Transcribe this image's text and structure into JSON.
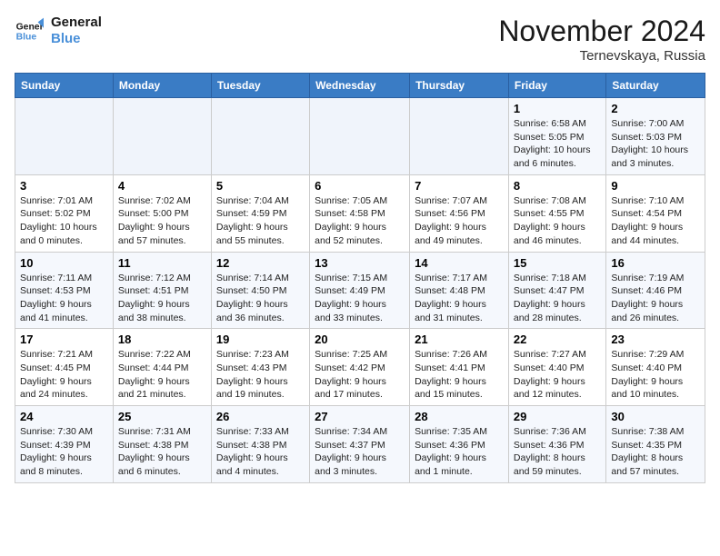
{
  "logo": {
    "line1": "General",
    "line2": "Blue"
  },
  "title": "November 2024",
  "location": "Ternevskaya, Russia",
  "weekdays": [
    "Sunday",
    "Monday",
    "Tuesday",
    "Wednesday",
    "Thursday",
    "Friday",
    "Saturday"
  ],
  "weeks": [
    [
      {
        "day": "",
        "info": ""
      },
      {
        "day": "",
        "info": ""
      },
      {
        "day": "",
        "info": ""
      },
      {
        "day": "",
        "info": ""
      },
      {
        "day": "",
        "info": ""
      },
      {
        "day": "1",
        "info": "Sunrise: 6:58 AM\nSunset: 5:05 PM\nDaylight: 10 hours and 6 minutes."
      },
      {
        "day": "2",
        "info": "Sunrise: 7:00 AM\nSunset: 5:03 PM\nDaylight: 10 hours and 3 minutes."
      }
    ],
    [
      {
        "day": "3",
        "info": "Sunrise: 7:01 AM\nSunset: 5:02 PM\nDaylight: 10 hours and 0 minutes."
      },
      {
        "day": "4",
        "info": "Sunrise: 7:02 AM\nSunset: 5:00 PM\nDaylight: 9 hours and 57 minutes."
      },
      {
        "day": "5",
        "info": "Sunrise: 7:04 AM\nSunset: 4:59 PM\nDaylight: 9 hours and 55 minutes."
      },
      {
        "day": "6",
        "info": "Sunrise: 7:05 AM\nSunset: 4:58 PM\nDaylight: 9 hours and 52 minutes."
      },
      {
        "day": "7",
        "info": "Sunrise: 7:07 AM\nSunset: 4:56 PM\nDaylight: 9 hours and 49 minutes."
      },
      {
        "day": "8",
        "info": "Sunrise: 7:08 AM\nSunset: 4:55 PM\nDaylight: 9 hours and 46 minutes."
      },
      {
        "day": "9",
        "info": "Sunrise: 7:10 AM\nSunset: 4:54 PM\nDaylight: 9 hours and 44 minutes."
      }
    ],
    [
      {
        "day": "10",
        "info": "Sunrise: 7:11 AM\nSunset: 4:53 PM\nDaylight: 9 hours and 41 minutes."
      },
      {
        "day": "11",
        "info": "Sunrise: 7:12 AM\nSunset: 4:51 PM\nDaylight: 9 hours and 38 minutes."
      },
      {
        "day": "12",
        "info": "Sunrise: 7:14 AM\nSunset: 4:50 PM\nDaylight: 9 hours and 36 minutes."
      },
      {
        "day": "13",
        "info": "Sunrise: 7:15 AM\nSunset: 4:49 PM\nDaylight: 9 hours and 33 minutes."
      },
      {
        "day": "14",
        "info": "Sunrise: 7:17 AM\nSunset: 4:48 PM\nDaylight: 9 hours and 31 minutes."
      },
      {
        "day": "15",
        "info": "Sunrise: 7:18 AM\nSunset: 4:47 PM\nDaylight: 9 hours and 28 minutes."
      },
      {
        "day": "16",
        "info": "Sunrise: 7:19 AM\nSunset: 4:46 PM\nDaylight: 9 hours and 26 minutes."
      }
    ],
    [
      {
        "day": "17",
        "info": "Sunrise: 7:21 AM\nSunset: 4:45 PM\nDaylight: 9 hours and 24 minutes."
      },
      {
        "day": "18",
        "info": "Sunrise: 7:22 AM\nSunset: 4:44 PM\nDaylight: 9 hours and 21 minutes."
      },
      {
        "day": "19",
        "info": "Sunrise: 7:23 AM\nSunset: 4:43 PM\nDaylight: 9 hours and 19 minutes."
      },
      {
        "day": "20",
        "info": "Sunrise: 7:25 AM\nSunset: 4:42 PM\nDaylight: 9 hours and 17 minutes."
      },
      {
        "day": "21",
        "info": "Sunrise: 7:26 AM\nSunset: 4:41 PM\nDaylight: 9 hours and 15 minutes."
      },
      {
        "day": "22",
        "info": "Sunrise: 7:27 AM\nSunset: 4:40 PM\nDaylight: 9 hours and 12 minutes."
      },
      {
        "day": "23",
        "info": "Sunrise: 7:29 AM\nSunset: 4:40 PM\nDaylight: 9 hours and 10 minutes."
      }
    ],
    [
      {
        "day": "24",
        "info": "Sunrise: 7:30 AM\nSunset: 4:39 PM\nDaylight: 9 hours and 8 minutes."
      },
      {
        "day": "25",
        "info": "Sunrise: 7:31 AM\nSunset: 4:38 PM\nDaylight: 9 hours and 6 minutes."
      },
      {
        "day": "26",
        "info": "Sunrise: 7:33 AM\nSunset: 4:38 PM\nDaylight: 9 hours and 4 minutes."
      },
      {
        "day": "27",
        "info": "Sunrise: 7:34 AM\nSunset: 4:37 PM\nDaylight: 9 hours and 3 minutes."
      },
      {
        "day": "28",
        "info": "Sunrise: 7:35 AM\nSunset: 4:36 PM\nDaylight: 9 hours and 1 minute."
      },
      {
        "day": "29",
        "info": "Sunrise: 7:36 AM\nSunset: 4:36 PM\nDaylight: 8 hours and 59 minutes."
      },
      {
        "day": "30",
        "info": "Sunrise: 7:38 AM\nSunset: 4:35 PM\nDaylight: 8 hours and 57 minutes."
      }
    ]
  ]
}
